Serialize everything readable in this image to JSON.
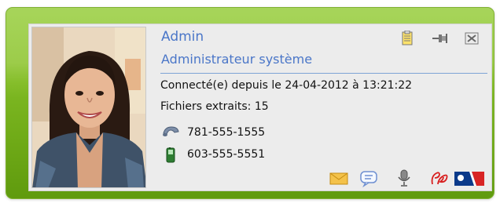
{
  "profile": {
    "name": "Admin",
    "role": "Administrateur système",
    "connected": "Connecté(e) depuis le 24-04-2012 à 13:21:22",
    "files": "Fichiers extraits: 15",
    "phone": "781-555-1555",
    "mobile": "603-555-5551"
  },
  "header_icons": [
    "notes-icon",
    "pin-icon",
    "close-icon"
  ],
  "action_icons": [
    "email-icon",
    "chat-icon",
    "microphone-icon",
    "ds-logo-icon",
    "flag-icon"
  ],
  "colors": {
    "frame_green": "#8cc33a",
    "card_bg": "#ececec",
    "name_blue": "#4a76c8",
    "divider_blue": "#7ea3d6"
  }
}
